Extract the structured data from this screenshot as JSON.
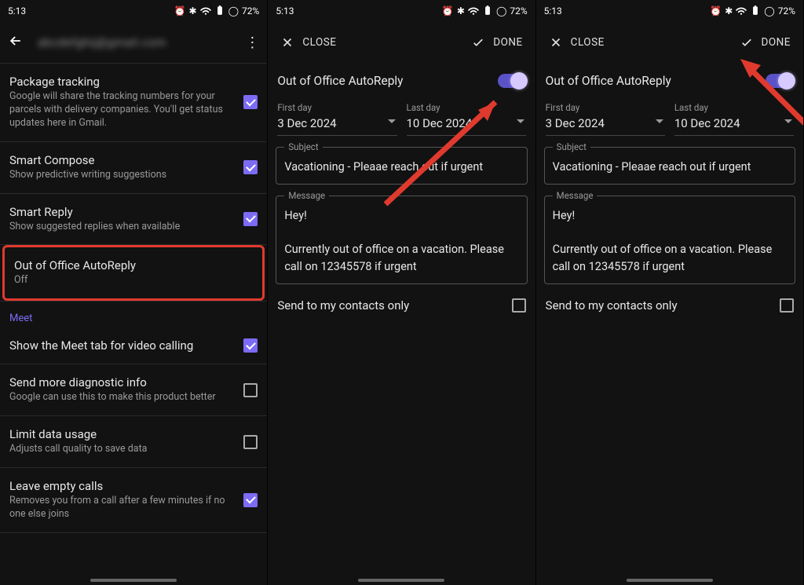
{
  "status": {
    "time": "5:13",
    "battery_pct": "72%"
  },
  "pane1": {
    "email": "abcdefghij@gmail.com",
    "items": [
      {
        "title": "Package tracking",
        "sub": "Google will share the tracking numbers for your parcels with delivery companies. You'll get status updates here in Gmail.",
        "checked": true,
        "highlight": false
      },
      {
        "title": "Smart Compose",
        "sub": "Show predictive writing suggestions",
        "checked": true,
        "highlight": false
      },
      {
        "title": "Smart Reply",
        "sub": "Show suggested replies when available",
        "checked": true,
        "highlight": false
      },
      {
        "title": "Out of Office AutoReply",
        "sub": "Off",
        "checked": null,
        "highlight": true
      }
    ],
    "section": "Meet",
    "meet_items": [
      {
        "title": "Show the Meet tab for video calling",
        "sub": "",
        "checked": true
      },
      {
        "title": "Send more diagnostic info",
        "sub": "Google can use this to make this product better",
        "checked": false
      },
      {
        "title": "Limit data usage",
        "sub": "Adjusts call quality to save data",
        "checked": false
      },
      {
        "title": "Leave empty calls",
        "sub": "Removes you from a call after a few minutes if no one else joins",
        "checked": true
      }
    ]
  },
  "pane2": {
    "close": "CLOSE",
    "done": "DONE",
    "toggle_label": "Out of Office AutoReply",
    "first_day_lbl": "First day",
    "first_day": "3 Dec 2024",
    "last_day_lbl": "Last day",
    "last_day": "10 Dec 2024",
    "subject_lbl": "Subject",
    "subject": "Vacationing - Pleaae reach out if urgent",
    "message_lbl": "Message",
    "message": "Hey!\n\nCurrently out of office on a vacation. Please call on 12345578 if urgent",
    "contacts_only": "Send to my contacts only"
  }
}
